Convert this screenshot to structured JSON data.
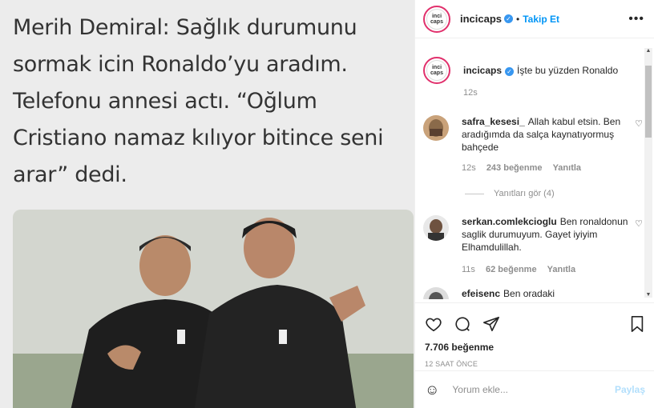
{
  "post": {
    "headline": "Merih Demiral: Sağlık durumunu sormak icin Ronaldo’yu aradım. Telefonu annesi actı. “Oğlum Cristiano namaz kılıyor bitince seni arar” dedi."
  },
  "header": {
    "username": "incicaps",
    "avatar_text": "inci caps",
    "separator": "•",
    "follow_label": "Takip Et",
    "more_label": "•••"
  },
  "caption": {
    "username": "incicaps",
    "text": "İşte bu yüzden Ronaldo",
    "time": "12s"
  },
  "comments": [
    {
      "username": "safra_kesesi_",
      "text": "Allah kabul etsin. Ben aradığımda da salça kaynatıyormuş bahçede",
      "time": "12s",
      "likes": "243 beğenme",
      "reply_label": "Yanıtla",
      "view_replies": "Yanıtları gör (4)"
    },
    {
      "username": "serkan.comlekcioglu",
      "text": "Ben ronaldonun saglik durumuyum. Gayet iyiyim Elhamdulillah.",
      "time": "11s",
      "likes": "62 beğenme",
      "reply_label": "Yanıtla"
    },
    {
      "username": "efeisenc",
      "text": "Ben oradaki"
    }
  ],
  "actions": {
    "likes_count": "7.706 beğenme",
    "posted_ago": "12 SAAT ÖNCE"
  },
  "composer": {
    "placeholder": "Yorum ekle...",
    "post_label": "Paylaş"
  },
  "icons": [
    "heart-icon",
    "comment-icon",
    "share-icon",
    "bookmark-icon",
    "emoji-icon",
    "verified-icon",
    "more-icon"
  ],
  "colors": {
    "accent": "#0095f6",
    "verified": "#3897f0",
    "post_disabled": "#b2dffc"
  }
}
